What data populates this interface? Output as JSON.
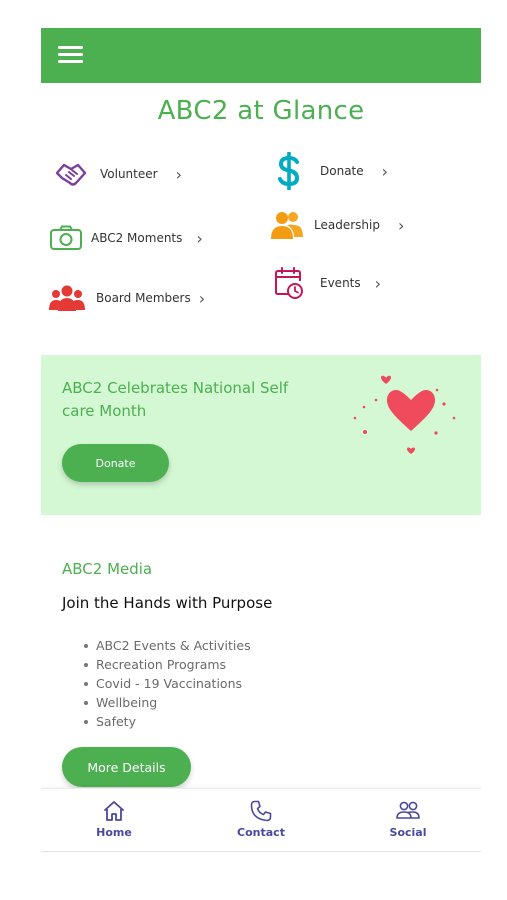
{
  "header": {
    "menu_icon": "hamburger-menu-icon",
    "color": "#4caf50"
  },
  "title": "ABC2 at Glance",
  "glance": {
    "volunteer": {
      "label": "Volunteer",
      "icon": "handshake-icon",
      "color": "#7b3fa0"
    },
    "donate": {
      "label": "Donate",
      "icon": "dollar-icon",
      "color": "#00acc1"
    },
    "moments": {
      "label": "ABC2 Moments",
      "icon": "camera-icon",
      "color": "#4caf50"
    },
    "leadership": {
      "label": "Leadership",
      "icon": "people-icon",
      "color": "#f39c12"
    },
    "board": {
      "label": "Board Members",
      "icon": "group-icon",
      "color": "#e53935"
    },
    "events": {
      "label": "Events",
      "icon": "calendar-clock-icon",
      "color": "#c2185b"
    },
    "chevron": "›"
  },
  "promo": {
    "title": "ABC2 Celebrates National Self care Month",
    "button": "Donate",
    "background": "#d4f8d4",
    "heart_color": "#ef4b5c"
  },
  "media": {
    "kicker": "ABC2 Media",
    "heading": "Join the Hands with Purpose",
    "items": [
      "ABC2 Events & Activities",
      "Recreation Programs",
      "Covid - 19 Vaccinations",
      "Wellbeing",
      "Safety"
    ],
    "button": "More Details"
  },
  "nav": {
    "home": {
      "label": "Home",
      "icon": "home-icon"
    },
    "contact": {
      "label": "Contact",
      "icon": "phone-icon"
    },
    "social": {
      "label": "Social",
      "icon": "people-outline-icon"
    },
    "color": "#4a4a9c"
  }
}
